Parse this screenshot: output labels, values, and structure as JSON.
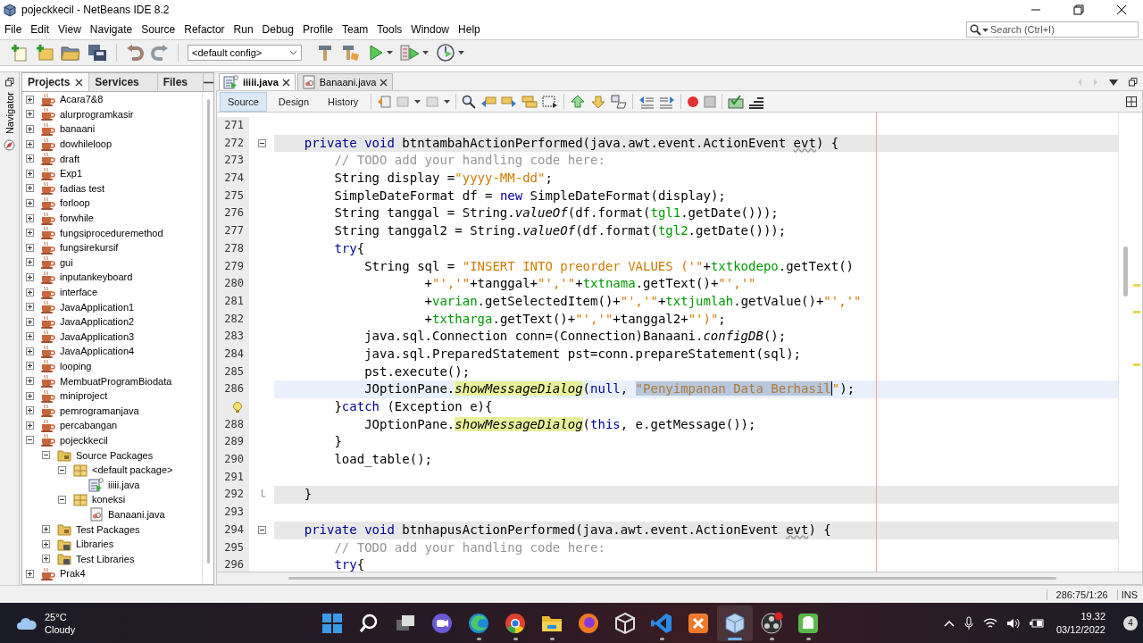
{
  "window": {
    "title": "pojeckkecil - NetBeans IDE 8.2"
  },
  "menu": [
    "File",
    "Edit",
    "View",
    "Navigate",
    "Source",
    "Refactor",
    "Run",
    "Debug",
    "Profile",
    "Team",
    "Tools",
    "Window",
    "Help"
  ],
  "search": {
    "placeholder": "Search (Ctrl+I)"
  },
  "toolbar": {
    "config": "<default config>"
  },
  "navigator": {
    "label": "Navigator"
  },
  "project_tabs": [
    {
      "label": "Projects",
      "selected": true
    },
    {
      "label": "Services",
      "selected": false
    },
    {
      "label": "Files",
      "selected": false
    }
  ],
  "projects": [
    {
      "label": "Acara7&8",
      "kind": "project",
      "expanded": false
    },
    {
      "label": "alurprogramkasir",
      "kind": "project",
      "expanded": false
    },
    {
      "label": "banaani",
      "kind": "project",
      "expanded": false
    },
    {
      "label": "dowhileloop",
      "kind": "project",
      "expanded": false
    },
    {
      "label": "draft",
      "kind": "project",
      "expanded": false
    },
    {
      "label": "Exp1",
      "kind": "project",
      "expanded": false
    },
    {
      "label": "fadias test",
      "kind": "project",
      "expanded": false
    },
    {
      "label": "forloop",
      "kind": "project",
      "expanded": false
    },
    {
      "label": "forwhile",
      "kind": "project",
      "expanded": false
    },
    {
      "label": "fungsiproceduremethod",
      "kind": "project",
      "expanded": false
    },
    {
      "label": "fungsirekursif",
      "kind": "project",
      "expanded": false
    },
    {
      "label": "gui",
      "kind": "project",
      "expanded": false
    },
    {
      "label": "inputankeyboard",
      "kind": "project",
      "expanded": false
    },
    {
      "label": "interface",
      "kind": "project",
      "expanded": false
    },
    {
      "label": "JavaApplication1",
      "kind": "project",
      "expanded": false
    },
    {
      "label": "JavaApplication2",
      "kind": "project",
      "expanded": false
    },
    {
      "label": "JavaApplication3",
      "kind": "project",
      "expanded": false
    },
    {
      "label": "JavaApplication4",
      "kind": "project",
      "expanded": false
    },
    {
      "label": "looping",
      "kind": "project",
      "expanded": false
    },
    {
      "label": "MembuatProgramBiodata",
      "kind": "project",
      "expanded": false
    },
    {
      "label": "miniproject",
      "kind": "project",
      "expanded": false
    },
    {
      "label": "pemrogramanjava",
      "kind": "project",
      "expanded": false
    },
    {
      "label": "percabangan",
      "kind": "project",
      "expanded": false
    },
    {
      "label": "pojeckkecil",
      "kind": "project",
      "expanded": true,
      "children": [
        {
          "label": "Source Packages",
          "kind": "folder",
          "expanded": true,
          "children": [
            {
              "label": "<default package>",
              "kind": "package",
              "expanded": true,
              "children": [
                {
                  "label": "iiiii.java",
                  "kind": "form"
                }
              ]
            },
            {
              "label": "koneksi",
              "kind": "package",
              "expanded": true,
              "children": [
                {
                  "label": "Banaani.java",
                  "kind": "class"
                }
              ]
            }
          ]
        },
        {
          "label": "Test Packages",
          "kind": "folder",
          "expanded": false
        },
        {
          "label": "Libraries",
          "kind": "library",
          "expanded": false
        },
        {
          "label": "Test Libraries",
          "kind": "library",
          "expanded": false
        }
      ]
    },
    {
      "label": "Prak4",
      "kind": "project",
      "expanded": false
    }
  ],
  "editor_tabs": [
    {
      "label": "iiiii.java",
      "kind": "form",
      "selected": true
    },
    {
      "label": "Banaani.java",
      "kind": "class",
      "selected": false
    }
  ],
  "view_tabs": [
    {
      "label": "Source",
      "selected": true
    },
    {
      "label": "Design",
      "selected": false
    },
    {
      "label": "History",
      "selected": false
    }
  ],
  "code_lines": [
    {
      "number": "271",
      "kind": "plain",
      "fold_start": false,
      "fold_end": false
    },
    {
      "number": "272",
      "kind": "marked",
      "fold_start": true,
      "fold_end": false,
      "tokens": [
        {
          "t": "    private void",
          "kind": "kw"
        },
        {
          "t": " btntambahActionPerformed(java.awt.event.ActionEvent ",
          "kind": "plain"
        },
        {
          "t": "evt",
          "kind": "warn"
        },
        {
          "t": ") {",
          "kind": "plain"
        }
      ]
    },
    {
      "number": "273",
      "kind": "plain",
      "fold_start": false,
      "fold_end": false,
      "tokens": [
        {
          "t": "        // TODO add your handling code here:",
          "kind": "com"
        }
      ]
    },
    {
      "number": "274",
      "kind": "plain",
      "fold_start": false,
      "fold_end": false,
      "tokens": [
        {
          "t": "        String display =",
          "kind": "plain"
        },
        {
          "t": "\"yyyy-MM-dd\"",
          "kind": "str"
        },
        {
          "t": ";",
          "kind": "plain"
        }
      ]
    },
    {
      "number": "275",
      "kind": "plain",
      "fold_start": false,
      "fold_end": false,
      "tokens": [
        {
          "t": "        SimpleDateFormat df = ",
          "kind": "plain"
        },
        {
          "t": "new",
          "kind": "kw"
        },
        {
          "t": " SimpleDateFormat(display);",
          "kind": "plain"
        }
      ]
    },
    {
      "number": "276",
      "kind": "plain",
      "fold_start": false,
      "fold_end": false,
      "tokens": [
        {
          "t": "        String tanggal = String.",
          "kind": "plain"
        },
        {
          "t": "valueOf",
          "kind": "ital"
        },
        {
          "t": "(df.format(",
          "kind": "plain"
        },
        {
          "t": "tgl1",
          "kind": "field"
        },
        {
          "t": ".getDate()));",
          "kind": "plain"
        }
      ]
    },
    {
      "number": "277",
      "kind": "plain",
      "fold_start": false,
      "fold_end": false,
      "tokens": [
        {
          "t": "        String tanggal2 = String.",
          "kind": "plain"
        },
        {
          "t": "valueOf",
          "kind": "ital"
        },
        {
          "t": "(df.format(",
          "kind": "plain"
        },
        {
          "t": "tgl2",
          "kind": "field"
        },
        {
          "t": ".getDate()));",
          "kind": "plain"
        }
      ]
    },
    {
      "number": "278",
      "kind": "plain",
      "fold_start": false,
      "fold_end": false,
      "tokens": [
        {
          "t": "        try",
          "kind": "kw"
        },
        {
          "t": "{",
          "kind": "plain"
        }
      ]
    },
    {
      "number": "279",
      "kind": "plain",
      "fold_start": false,
      "fold_end": false,
      "tokens": [
        {
          "t": "            String sql = ",
          "kind": "plain"
        },
        {
          "t": "\"INSERT INTO preorder VALUES ('\"",
          "kind": "str"
        },
        {
          "t": "+",
          "kind": "plain"
        },
        {
          "t": "txtkodepo",
          "kind": "field"
        },
        {
          "t": ".getText()",
          "kind": "plain"
        }
      ]
    },
    {
      "number": "280",
      "kind": "plain",
      "fold_start": false,
      "fold_end": false,
      "tokens": [
        {
          "t": "                    +",
          "kind": "plain"
        },
        {
          "t": "\"','\"",
          "kind": "str"
        },
        {
          "t": "+tanggal+",
          "kind": "plain"
        },
        {
          "t": "\"','\"",
          "kind": "str"
        },
        {
          "t": "+",
          "kind": "plain"
        },
        {
          "t": "txtnama",
          "kind": "field"
        },
        {
          "t": ".getText()+",
          "kind": "plain"
        },
        {
          "t": "\"','\"",
          "kind": "str"
        }
      ]
    },
    {
      "number": "281",
      "kind": "plain",
      "fold_start": false,
      "fold_end": false,
      "tokens": [
        {
          "t": "                    +",
          "kind": "plain"
        },
        {
          "t": "varian",
          "kind": "field"
        },
        {
          "t": ".getSelectedItem()+",
          "kind": "plain"
        },
        {
          "t": "\"','\"",
          "kind": "str"
        },
        {
          "t": "+",
          "kind": "plain"
        },
        {
          "t": "txtjumlah",
          "kind": "field"
        },
        {
          "t": ".getValue()+",
          "kind": "plain"
        },
        {
          "t": "\"','\"",
          "kind": "str"
        }
      ]
    },
    {
      "number": "282",
      "kind": "plain",
      "fold_start": false,
      "fold_end": false,
      "tokens": [
        {
          "t": "                    +",
          "kind": "plain"
        },
        {
          "t": "txtharga",
          "kind": "field"
        },
        {
          "t": ".getText()+",
          "kind": "plain"
        },
        {
          "t": "\"','\"",
          "kind": "str"
        },
        {
          "t": "+tanggal2+",
          "kind": "plain"
        },
        {
          "t": "\"')\"",
          "kind": "str"
        },
        {
          "t": ";",
          "kind": "plain"
        }
      ]
    },
    {
      "number": "283",
      "kind": "plain",
      "fold_start": false,
      "fold_end": false,
      "tokens": [
        {
          "t": "            java.sql.Connection conn=(Connection)Banaani.",
          "kind": "plain"
        },
        {
          "t": "configDB",
          "kind": "ital"
        },
        {
          "t": "();",
          "kind": "plain"
        }
      ]
    },
    {
      "number": "284",
      "kind": "plain",
      "fold_start": false,
      "fold_end": false,
      "tokens": [
        {
          "t": "            java.sql.PreparedStatement pst=conn.prepareStatement(sql);",
          "kind": "plain"
        }
      ]
    },
    {
      "number": "285",
      "kind": "plain",
      "fold_start": false,
      "fold_end": false,
      "tokens": [
        {
          "t": "            pst.execute();",
          "kind": "plain"
        }
      ]
    },
    {
      "number": "286",
      "kind": "current",
      "fold_start": false,
      "fold_end": false,
      "tokens": [
        {
          "t": "            JOptionPane.",
          "kind": "plain"
        },
        {
          "t": "showMessageDialog",
          "kind": "call"
        },
        {
          "t": "(",
          "kind": "plain"
        },
        {
          "t": "null",
          "kind": "kw"
        },
        {
          "t": ", ",
          "kind": "plain"
        },
        {
          "t": "\"Penyimpanan Data Berhasil",
          "kind": "sel"
        },
        {
          "t": "\"",
          "kind": "str"
        },
        {
          "t": ");",
          "kind": "plain"
        }
      ]
    },
    {
      "kind": "hint",
      "fold_start": false,
      "fold_end": false,
      "tokens": [
        {
          "t": "        }",
          "kind": "plain"
        },
        {
          "t": "catch",
          "kind": "kw"
        },
        {
          "t": " (Exception e){",
          "kind": "plain"
        }
      ]
    },
    {
      "number": "288",
      "kind": "plain",
      "fold_start": false,
      "fold_end": false,
      "tokens": [
        {
          "t": "            JOptionPane.",
          "kind": "plain"
        },
        {
          "t": "showMessageDialog",
          "kind": "call"
        },
        {
          "t": "(",
          "kind": "plain"
        },
        {
          "t": "this",
          "kind": "kw"
        },
        {
          "t": ", e.getMessage());",
          "kind": "plain"
        }
      ]
    },
    {
      "number": "289",
      "kind": "plain",
      "fold_start": false,
      "fold_end": false,
      "tokens": [
        {
          "t": "        }",
          "kind": "plain"
        }
      ]
    },
    {
      "number": "290",
      "kind": "plain",
      "fold_start": false,
      "fold_end": false,
      "tokens": [
        {
          "t": "        load_table();",
          "kind": "plain"
        }
      ]
    },
    {
      "number": "291",
      "kind": "plain",
      "fold_start": false,
      "fold_end": false
    },
    {
      "number": "292",
      "kind": "marked",
      "fold_start": false,
      "fold_end": true,
      "tokens": [
        {
          "t": "    }",
          "kind": "plain"
        }
      ]
    },
    {
      "number": "293",
      "kind": "plain",
      "fold_start": false,
      "fold_end": false
    },
    {
      "number": "294",
      "kind": "marked",
      "fold_start": true,
      "fold_end": false,
      "tokens": [
        {
          "t": "    private void",
          "kind": "kw"
        },
        {
          "t": " btnhapusActionPerformed(java.awt.event.ActionEvent ",
          "kind": "plain"
        },
        {
          "t": "evt",
          "kind": "warn"
        },
        {
          "t": ") {",
          "kind": "plain"
        }
      ]
    },
    {
      "number": "295",
      "kind": "plain",
      "fold_start": false,
      "fold_end": false,
      "tokens": [
        {
          "t": "        // TODO add your handling code here:",
          "kind": "com"
        }
      ]
    },
    {
      "number": "296",
      "kind": "plain",
      "fold_start": false,
      "fold_end": false,
      "tokens": [
        {
          "t": "        try",
          "kind": "kw"
        },
        {
          "t": "{",
          "kind": "plain"
        }
      ]
    }
  ],
  "status_bar": {
    "position": "286:75/1:26",
    "mode": "INS"
  },
  "taskbar": {
    "weather": {
      "temperature": "25°C",
      "condition": "Cloudy"
    },
    "apps": [
      {
        "kind": "start",
        "running": false,
        "selected": false
      },
      {
        "kind": "search",
        "running": false,
        "selected": false
      },
      {
        "kind": "taskview",
        "running": false,
        "selected": false
      },
      {
        "kind": "chat",
        "running": false,
        "selected": false
      },
      {
        "kind": "edge",
        "running": true,
        "selected": false
      },
      {
        "kind": "chrome",
        "running": true,
        "selected": false
      },
      {
        "kind": "explorer",
        "running": true,
        "selected": false
      },
      {
        "kind": "firefox",
        "running": false,
        "selected": false
      },
      {
        "kind": "virtualbox",
        "running": false,
        "selected": false
      },
      {
        "kind": "vscode",
        "running": true,
        "selected": false
      },
      {
        "kind": "xampp",
        "running": false,
        "selected": false
      },
      {
        "kind": "netbeans",
        "running": true,
        "selected": true
      },
      {
        "kind": "obs",
        "running": true,
        "selected": false
      },
      {
        "kind": "android",
        "running": true,
        "selected": false
      }
    ],
    "time": "19.32",
    "date": "03/12/2022",
    "notifications": "4"
  }
}
